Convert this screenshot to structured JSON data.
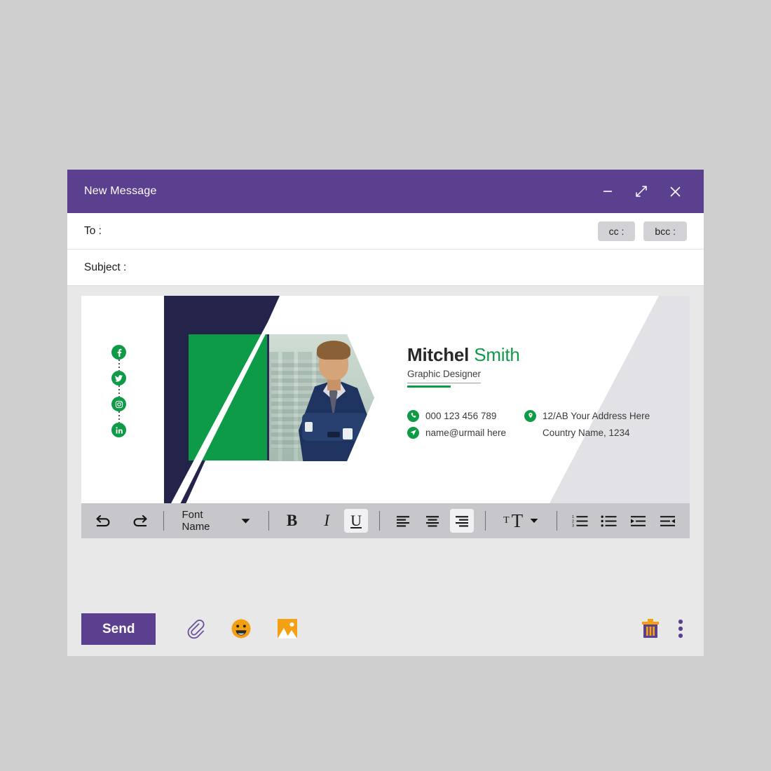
{
  "window": {
    "title": "New Message",
    "controls": [
      {
        "name": "minimize",
        "label": "minimize-icon"
      },
      {
        "name": "expand",
        "label": "expand-icon"
      },
      {
        "name": "close",
        "label": "close-icon"
      }
    ]
  },
  "compose": {
    "to_label": "To :",
    "to_value": "",
    "to_placeholder": "",
    "cc_label": "cc :",
    "bcc_label": "bcc :",
    "subject_label": "Subject :",
    "subject_value": "",
    "subject_placeholder": ""
  },
  "signature": {
    "first_name": "Mitchel",
    "last_name": "Smith",
    "role": "Graphic Designer",
    "phone": "000 123 456 789",
    "email": "name@urmail here",
    "address_line1": "12/AB Your Address Here",
    "address_line2": "Country Name, 1234",
    "socials": [
      {
        "name": "facebook",
        "icon": "facebook-icon"
      },
      {
        "name": "twitter",
        "icon": "twitter-icon"
      },
      {
        "name": "instagram",
        "icon": "instagram-icon"
      },
      {
        "name": "linkedin",
        "icon": "linkedin-icon"
      }
    ],
    "colors": {
      "green": "#0d9b47",
      "navy": "#24234a",
      "gray_wedge": "#e2e2e6"
    }
  },
  "toolbar": {
    "undo_label": "undo-icon",
    "redo_label": "redo-icon",
    "font_name": "Font Name",
    "bold_label": "B",
    "italic_label": "I",
    "underline_label": "U",
    "align_left_label": "align-left-icon",
    "align_center_label": "align-center-icon",
    "align_justify_label": "align-justify-icon",
    "font_size_small": "T",
    "font_size_large": "T",
    "numbered_list_label": "numbered-list-icon",
    "bulleted_list_label": "bulleted-list-icon",
    "indent_increase_label": "indent-increase-icon",
    "indent_decrease_label": "indent-decrease-icon",
    "active_buttons": [
      "underline",
      "align-justify"
    ]
  },
  "actions": {
    "send_label": "Send",
    "attach_label": "attachment-icon",
    "emoji_label": "emoji-icon",
    "image_label": "image-icon",
    "delete_label": "trash-icon",
    "more_label": "more-options-icon"
  },
  "theme": {
    "purple": "#5b4090",
    "orange": "#f5a012",
    "page_bg": "#cfcfcf",
    "body_bg": "#e8e8e8",
    "toolbar_bg": "#c6c6cb"
  }
}
